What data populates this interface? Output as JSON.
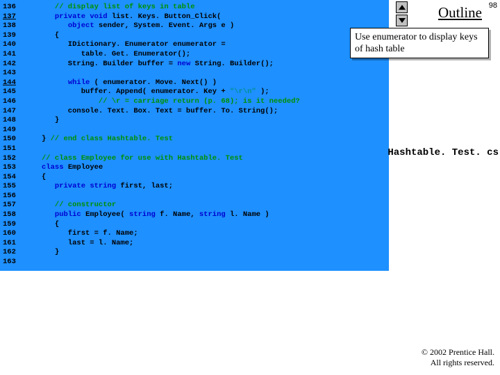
{
  "page_number": "98",
  "outline_label": "Outline",
  "callout_text": "Use enumerator to display keys of hash table",
  "filename": "Hashtable. Test. cs",
  "footer_line1": "© 2002 Prentice Hall.",
  "footer_line2": "All rights reserved.",
  "gutter": [
    {
      "n": "136",
      "u": false
    },
    {
      "n": "137",
      "u": true
    },
    {
      "n": "138",
      "u": false
    },
    {
      "n": "139",
      "u": false
    },
    {
      "n": "140",
      "u": false
    },
    {
      "n": "141",
      "u": false
    },
    {
      "n": "142",
      "u": false
    },
    {
      "n": "143",
      "u": false
    },
    {
      "n": "144",
      "u": true
    },
    {
      "n": "145",
      "u": false
    },
    {
      "n": "146",
      "u": false
    },
    {
      "n": "147",
      "u": false
    },
    {
      "n": "148",
      "u": false
    },
    {
      "n": "149",
      "u": false
    },
    {
      "n": "150",
      "u": false
    },
    {
      "n": "151",
      "u": false
    },
    {
      "n": "152",
      "u": false
    },
    {
      "n": "153",
      "u": false
    },
    {
      "n": "154",
      "u": false
    },
    {
      "n": "155",
      "u": false
    },
    {
      "n": "156",
      "u": false
    },
    {
      "n": "157",
      "u": false
    },
    {
      "n": "158",
      "u": false
    },
    {
      "n": "159",
      "u": false
    },
    {
      "n": "160",
      "u": false
    },
    {
      "n": "161",
      "u": false
    },
    {
      "n": "162",
      "u": false
    },
    {
      "n": "163",
      "u": false
    }
  ],
  "code_lines": [
    [
      {
        "c": "cmt",
        "t": "   // display list of keys in table"
      }
    ],
    [
      {
        "c": "rest",
        "t": "   "
      },
      {
        "c": "kw",
        "t": "private void "
      },
      {
        "c": "rest",
        "t": "list. Keys. Button_Click("
      }
    ],
    [
      {
        "c": "rest",
        "t": "      "
      },
      {
        "c": "kw",
        "t": "object "
      },
      {
        "c": "rest",
        "t": "sender, System. Event. Args e )"
      }
    ],
    [
      {
        "c": "rest",
        "t": "   {"
      }
    ],
    [
      {
        "c": "rest",
        "t": "      IDictionary. Enumerator enumerator ="
      }
    ],
    [
      {
        "c": "rest",
        "t": "         table. Get. Enumerator();"
      }
    ],
    [
      {
        "c": "rest",
        "t": "      String. Builder buffer = "
      },
      {
        "c": "kw",
        "t": "new "
      },
      {
        "c": "rest",
        "t": "String. Builder();"
      }
    ],
    [
      {
        "c": "rest",
        "t": ""
      }
    ],
    [
      {
        "c": "rest",
        "t": "      "
      },
      {
        "c": "kw",
        "t": "while"
      },
      {
        "c": "rest",
        "t": " ( enumerator. Move. Next() )"
      }
    ],
    [
      {
        "c": "rest",
        "t": "         buffer. Append( enumerator. Key + "
      },
      {
        "c": "str",
        "t": "\"\\r\\n\""
      },
      {
        "c": "rest",
        "t": " );"
      }
    ],
    [
      {
        "c": "rest",
        "t": "             "
      },
      {
        "c": "cmt",
        "t": "// \\r = carriage return (p. 68); is it needed?"
      }
    ],
    [
      {
        "c": "rest",
        "t": "      console. Text. Box. Text = buffer. To. String();"
      }
    ],
    [
      {
        "c": "rest",
        "t": "   }"
      }
    ],
    [
      {
        "c": "rest",
        "t": ""
      }
    ],
    [
      {
        "c": "rest",
        "t": "} "
      },
      {
        "c": "cmt",
        "t": "// end class Hashtable. Test"
      }
    ],
    [
      {
        "c": "rest",
        "t": ""
      }
    ],
    [
      {
        "c": "cmt",
        "t": "// class Employee for use with Hashtable. Test"
      }
    ],
    [
      {
        "c": "kw",
        "t": "class "
      },
      {
        "c": "rest",
        "t": "Employee"
      }
    ],
    [
      {
        "c": "rest",
        "t": "{"
      }
    ],
    [
      {
        "c": "rest",
        "t": "   "
      },
      {
        "c": "kw",
        "t": "private string "
      },
      {
        "c": "rest",
        "t": "first, last;"
      }
    ],
    [
      {
        "c": "rest",
        "t": ""
      }
    ],
    [
      {
        "c": "rest",
        "t": "   "
      },
      {
        "c": "cmt",
        "t": "// constructor"
      }
    ],
    [
      {
        "c": "rest",
        "t": "   "
      },
      {
        "c": "kw",
        "t": "public "
      },
      {
        "c": "rest",
        "t": "Employee( "
      },
      {
        "c": "kw",
        "t": "string "
      },
      {
        "c": "rest",
        "t": "f. Name, "
      },
      {
        "c": "kw",
        "t": "string "
      },
      {
        "c": "rest",
        "t": "l. Name )"
      }
    ],
    [
      {
        "c": "rest",
        "t": "   {"
      }
    ],
    [
      {
        "c": "rest",
        "t": "      first = f. Name;"
      }
    ],
    [
      {
        "c": "rest",
        "t": "      last = l. Name;"
      }
    ],
    [
      {
        "c": "rest",
        "t": "   }"
      }
    ],
    [
      {
        "c": "rest",
        "t": ""
      }
    ]
  ]
}
